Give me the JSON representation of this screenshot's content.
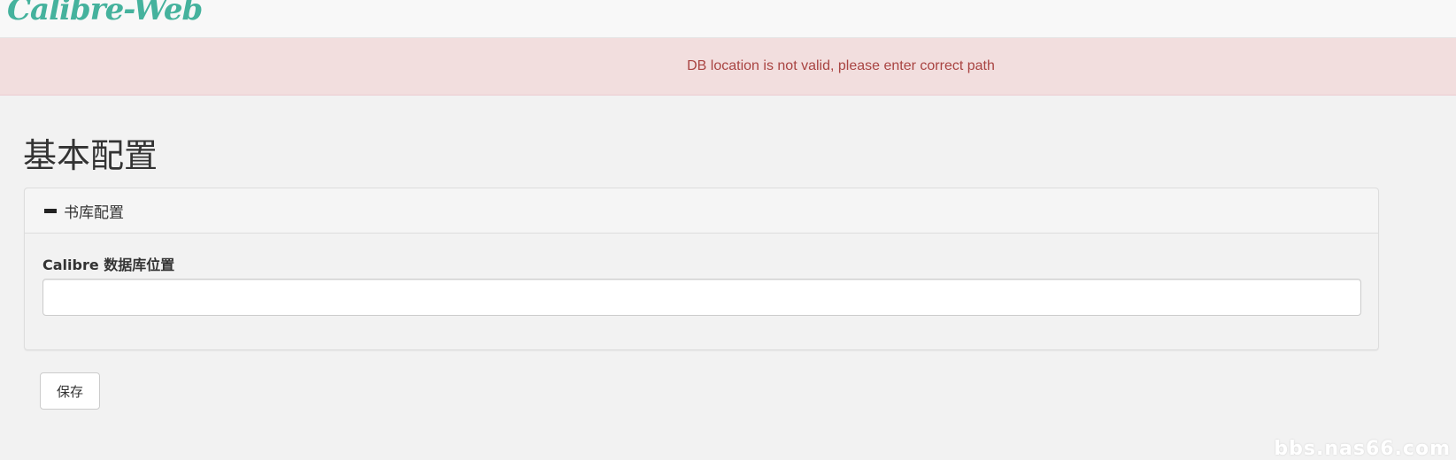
{
  "navbar": {
    "brand": "Calibre-Web"
  },
  "alert": {
    "message": "DB location is not valid, please enter correct path"
  },
  "page": {
    "title": "基本配置"
  },
  "panel": {
    "heading": "书库配置",
    "collapse_icon": "minus-icon"
  },
  "form": {
    "db_location_label": "Calibre 数据库位置",
    "db_location_value": "",
    "db_location_placeholder": ""
  },
  "actions": {
    "save_label": "保存"
  },
  "watermark": {
    "text": "bbs.nas66.com"
  },
  "colors": {
    "brand": "#45b29d",
    "alert_bg": "#f2dede",
    "alert_text": "#a94442",
    "page_bg": "#f2f2f2"
  }
}
